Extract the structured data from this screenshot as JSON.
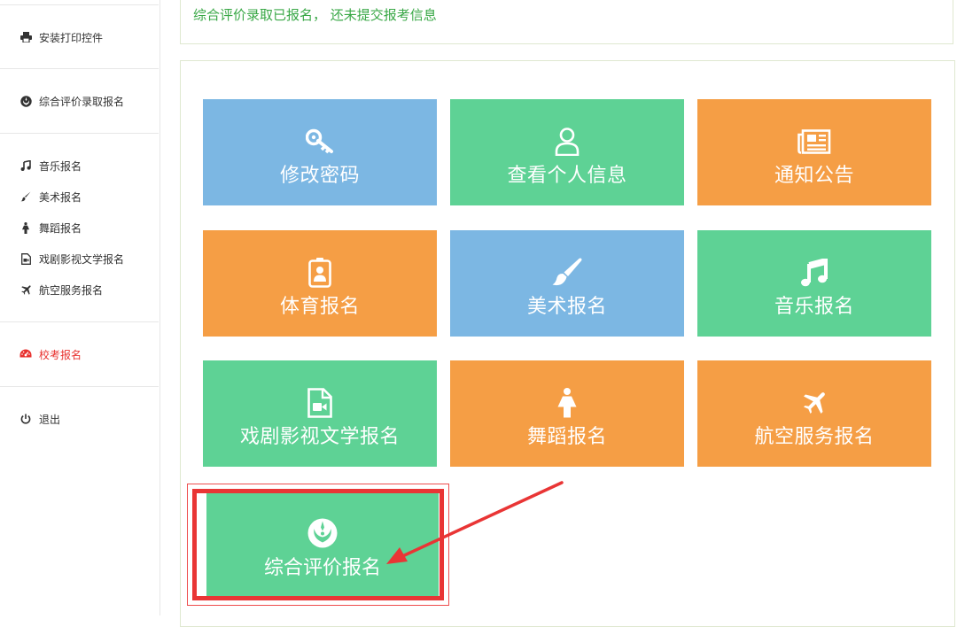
{
  "sidebar": {
    "items": [
      {
        "label": "安装打印控件",
        "icon": "printer-icon"
      },
      {
        "label": "综合评价录取报名",
        "icon": "rebel-icon"
      },
      {
        "label": "音乐报名",
        "icon": "music-icon"
      },
      {
        "label": "美术报名",
        "icon": "paintbrush-icon"
      },
      {
        "label": "舞蹈报名",
        "icon": "female-icon"
      },
      {
        "label": "戏剧影视文学报名",
        "icon": "video-file-icon"
      },
      {
        "label": "航空服务报名",
        "icon": "plane-icon"
      },
      {
        "label": "校考报名",
        "icon": "dashboard-icon",
        "active": true
      },
      {
        "label": "退出",
        "icon": "power-icon"
      }
    ],
    "active_color": "#e8322f"
  },
  "notice": {
    "text": "综合评价录取已报名， 还未提交报考信息",
    "color": "#3aa847"
  },
  "tiles": [
    {
      "label": "修改密码",
      "icon": "key-icon",
      "color": "#7cb7e3"
    },
    {
      "label": "查看个人信息",
      "icon": "user-icon",
      "color": "#5ed295"
    },
    {
      "label": "通知公告",
      "icon": "newspaper-icon",
      "color": "#f59e45"
    },
    {
      "label": "体育报名",
      "icon": "id-badge-icon",
      "color": "#f59e45"
    },
    {
      "label": "美术报名",
      "icon": "paintbrush-icon",
      "color": "#7cb7e3"
    },
    {
      "label": "音乐报名",
      "icon": "music-icon",
      "color": "#5ed295"
    },
    {
      "label": "戏剧影视文学报名",
      "icon": "video-file-icon",
      "color": "#5ed295"
    },
    {
      "label": "舞蹈报名",
      "icon": "female-icon",
      "color": "#f59e45"
    },
    {
      "label": "航空服务报名",
      "icon": "plane-icon",
      "color": "#f59e45"
    },
    {
      "label": "综合评价报名",
      "icon": "rebel-icon",
      "color": "#5ed295",
      "highlighted": true
    }
  ],
  "annotation": {
    "highlight_color": "#e93535"
  }
}
